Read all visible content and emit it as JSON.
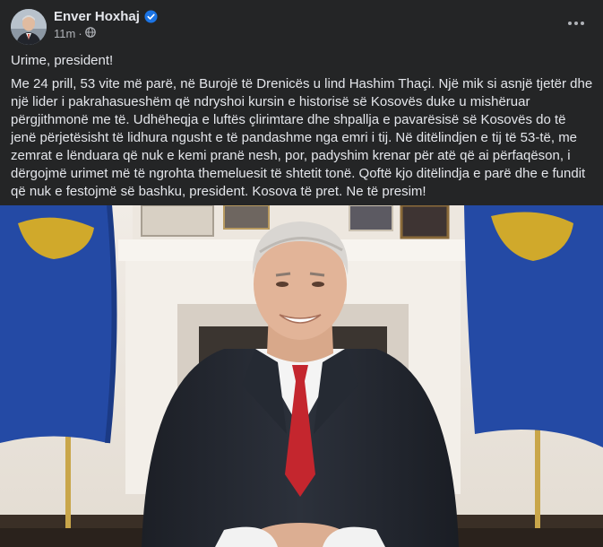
{
  "post": {
    "author": "Enver Hoxhaj",
    "time": "11m",
    "separator": "·",
    "visibility_icon": "globe-icon",
    "greeting": "Urime, president!",
    "body": "Me 24 prill, 53  vite më parë, në Burojë të Drenicës u lind Hashim Thaçi. Një mik si asnjë tjetër dhe një lider i pakrahasueshëm që ndryshoi kursin e historisë së Kosovës duke u mishëruar përgjithmonë me të. Udhëheqja e luftës çlirimtare dhe shpallja e pavarësisë së Kosovës do të jenë përjetësisht të lidhura ngusht e të pandashme nga emri i tij. Në ditëlindjen e tij të 53-të, me zemrat e lënduara që nuk e kemi pranë nesh, por, padyshim krenar për atë që ai përfaqëson, i dërgojmë urimet më të ngrohta themeluesit të shtetit tonë. Qoftë kjo ditëlindja e parë dhe e fundit që nuk e festojmë së bashku, president. Kosova të pret. Ne të presim!"
  },
  "colors": {
    "background": "#242526",
    "text_primary": "#e4e6eb",
    "text_secondary": "#b0b3b8",
    "verified_badge": "#1b74e4",
    "flag_blue": "#244aa5",
    "flag_gold": "#d0a92b"
  }
}
